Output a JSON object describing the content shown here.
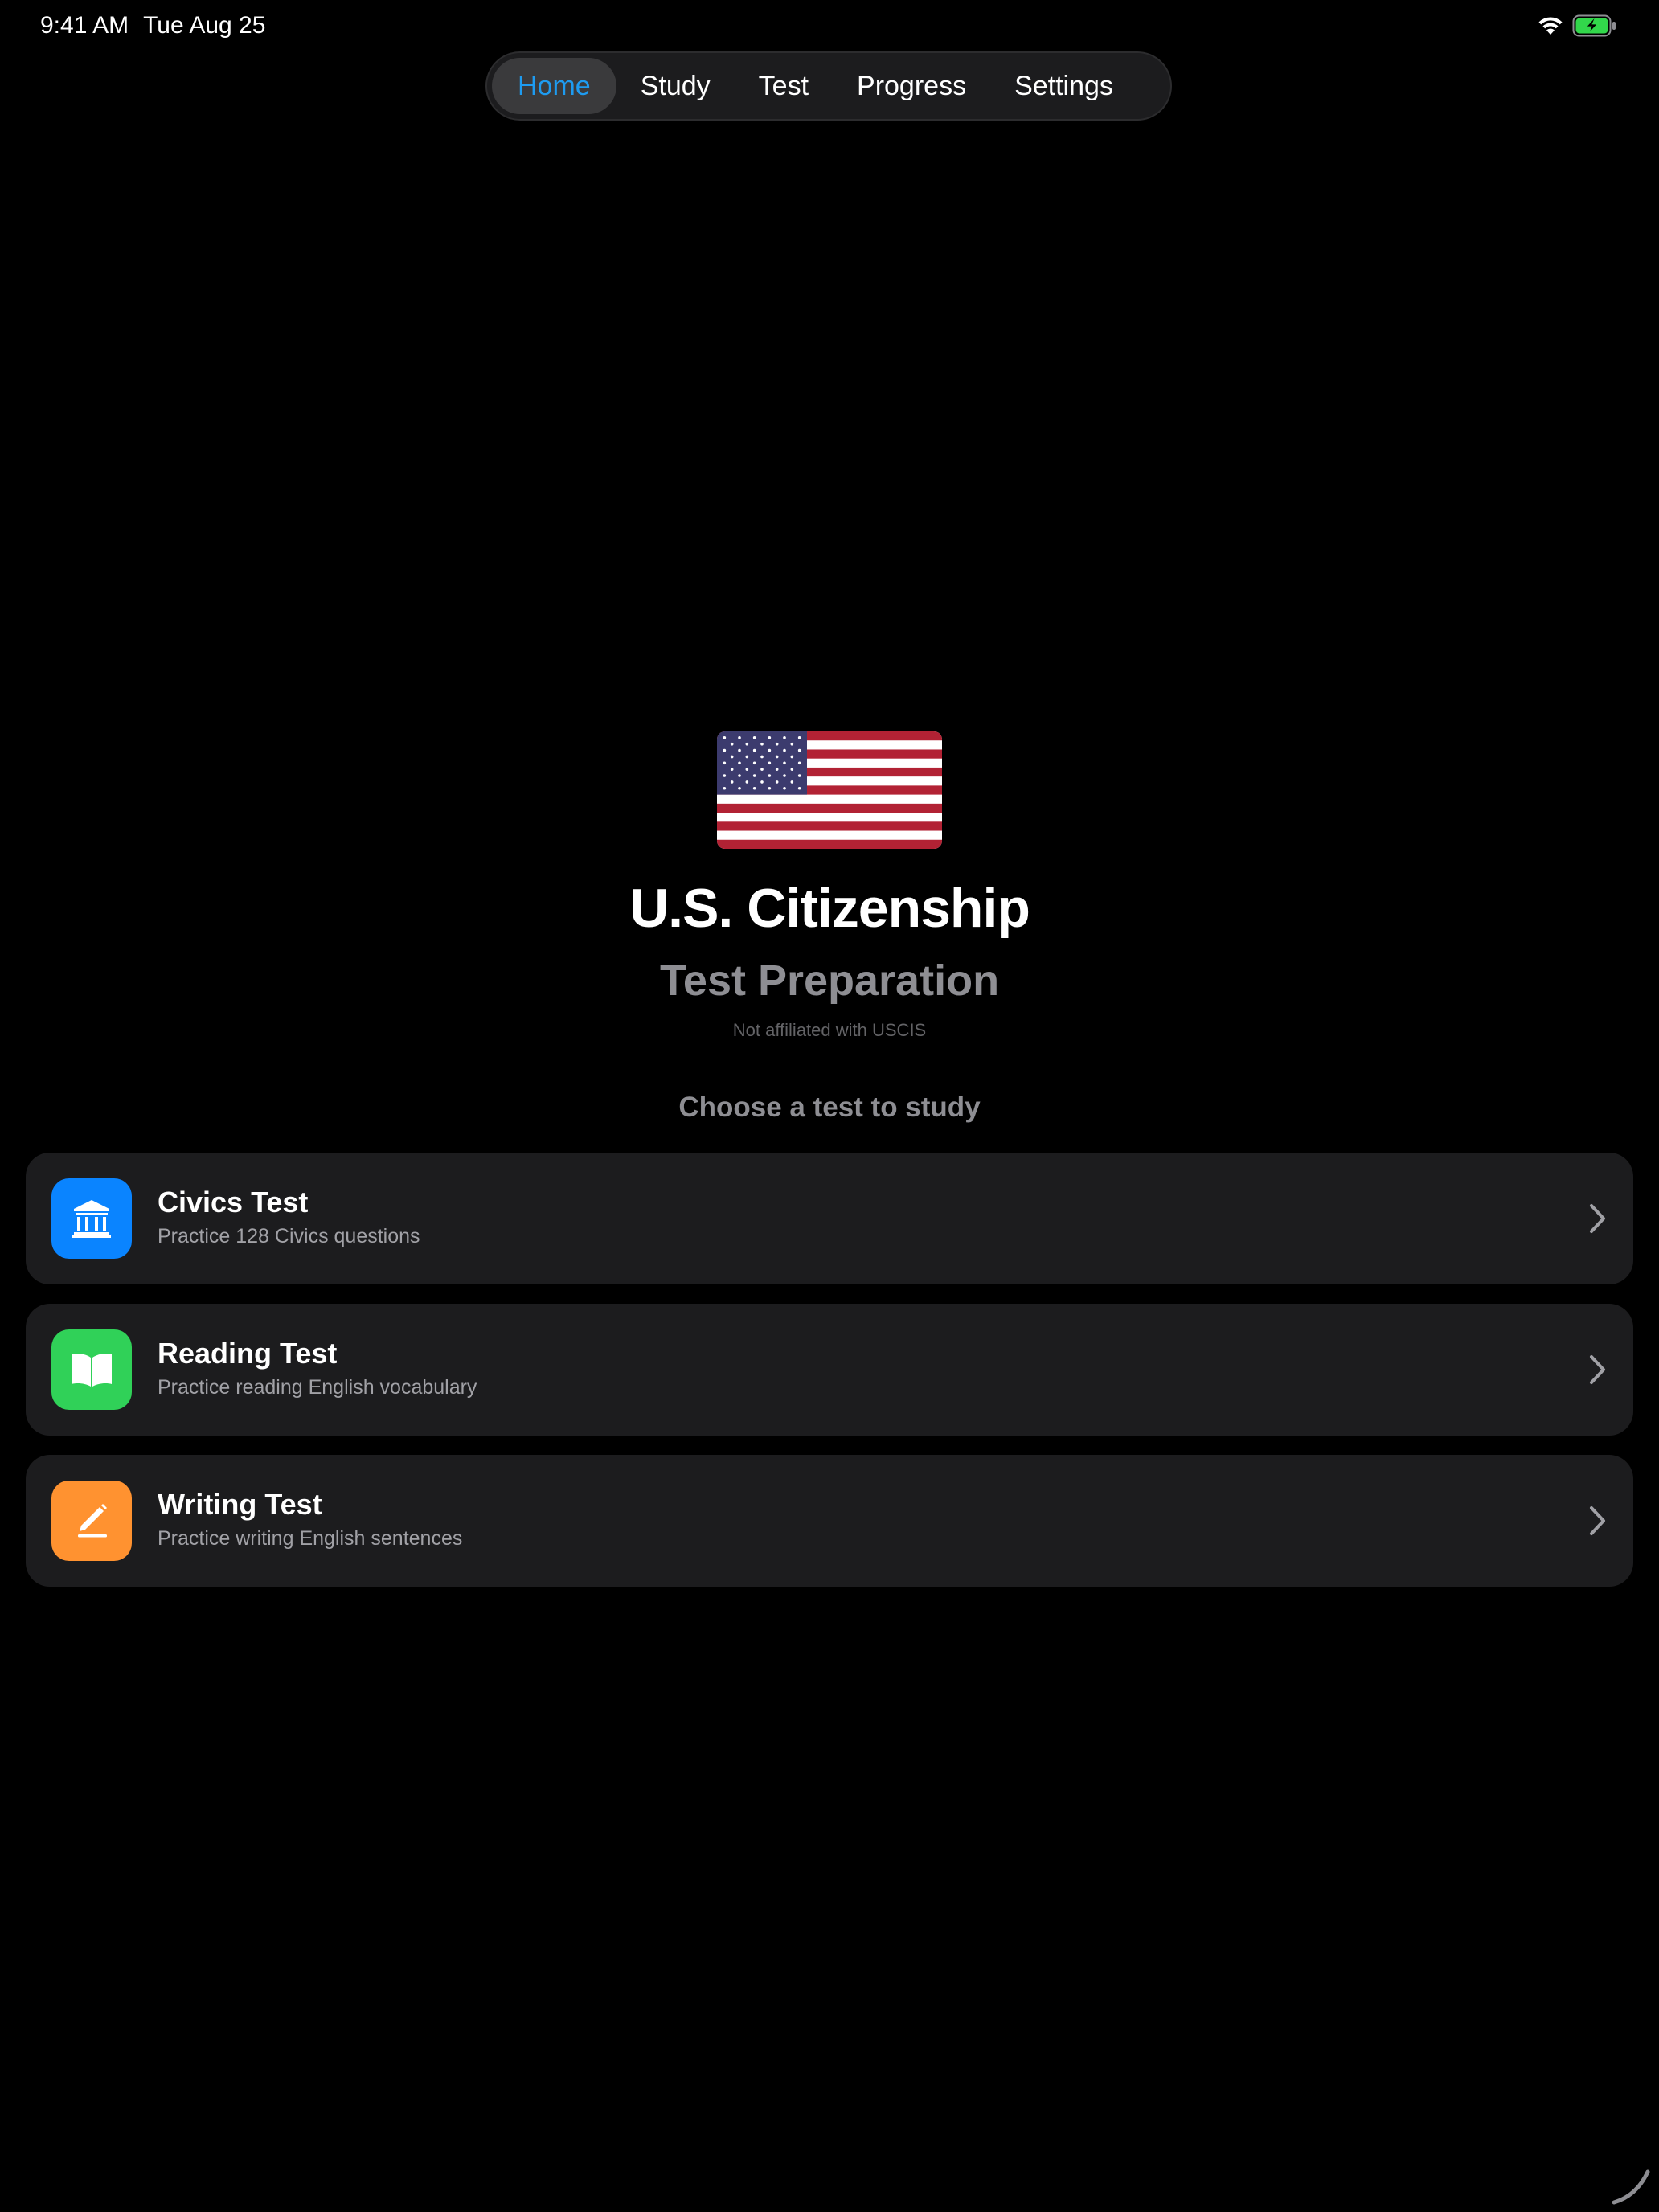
{
  "status_bar": {
    "time": "9:41 AM",
    "date": "Tue Aug 25",
    "icons": [
      "wifi-icon",
      "battery-charging-icon"
    ]
  },
  "nav": {
    "tabs": [
      {
        "label": "Home",
        "active": true
      },
      {
        "label": "Study",
        "active": false
      },
      {
        "label": "Test",
        "active": false
      },
      {
        "label": "Progress",
        "active": false
      },
      {
        "label": "Settings",
        "active": false
      }
    ]
  },
  "hero": {
    "flag_icon": "us-flag-icon",
    "title": "U.S. Citizenship",
    "subtitle": "Test Preparation",
    "disclaimer": "Not affiliated with USCIS"
  },
  "prompt": "Choose a test to study",
  "tests": [
    {
      "title": "Civics Test",
      "description": "Practice 128 Civics questions",
      "icon": "building-columns-icon",
      "color": "#0a84ff"
    },
    {
      "title": "Reading Test",
      "description": "Practice reading English vocabulary",
      "icon": "book-icon",
      "color": "#30d158"
    },
    {
      "title": "Writing Test",
      "description": "Practice writing English sentences",
      "icon": "pencil-line-icon",
      "color": "#ff9230"
    }
  ],
  "colors": {
    "background": "#000000",
    "card": "#1c1c1e",
    "accent": "#1e9bf0",
    "secondary_text": "#8e8e93"
  }
}
